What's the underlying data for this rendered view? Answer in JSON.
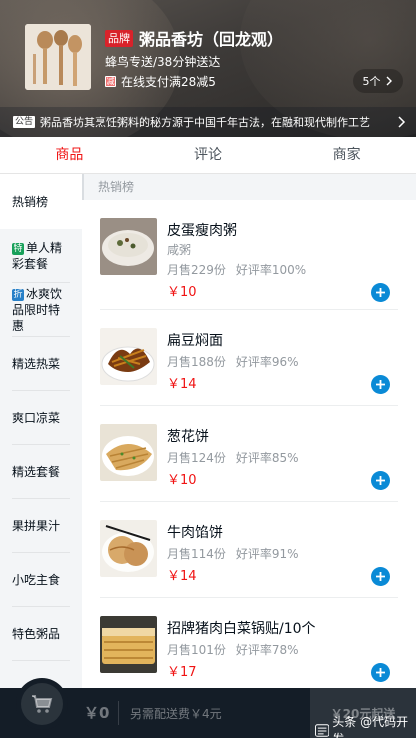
{
  "header": {
    "brand_badge": "品牌",
    "shop_name": "粥品香坊（回龙观）",
    "delivery": "蜂鸟专送/38分钟送达",
    "promo_icon": "减",
    "promo": "在线支付满28减5",
    "promo_count": "5个",
    "notice_tag": "公告",
    "notice": "粥品香坊其烹饪粥料的秘方源于中国千年古法，在融和现代制作工艺"
  },
  "tabs": [
    "商品",
    "评论",
    "商家"
  ],
  "menu": [
    {
      "tag": "",
      "label": "热销榜"
    },
    {
      "tag": "特",
      "label": "单人精彩套餐"
    },
    {
      "tag": "折",
      "label": "冰爽饮品限时特惠"
    },
    {
      "tag": "",
      "label": "精选热菜"
    },
    {
      "tag": "",
      "label": "爽口凉菜"
    },
    {
      "tag": "",
      "label": "精选套餐"
    },
    {
      "tag": "",
      "label": "果拼果汁"
    },
    {
      "tag": "",
      "label": "小吃主食"
    },
    {
      "tag": "",
      "label": "特色粥品"
    }
  ],
  "section_title": "热销榜",
  "foods": [
    {
      "name": "皮蛋瘦肉粥",
      "desc": "咸粥",
      "sales": "月售229份",
      "rating": "好评率100%",
      "price": "￥10"
    },
    {
      "name": "扁豆焖面",
      "desc": "",
      "sales": "月售188份",
      "rating": "好评率96%",
      "price": "￥14"
    },
    {
      "name": "葱花饼",
      "desc": "",
      "sales": "月售124份",
      "rating": "好评率85%",
      "price": "￥10"
    },
    {
      "name": "牛肉馅饼",
      "desc": "",
      "sales": "月售114份",
      "rating": "好评率91%",
      "price": "￥14"
    },
    {
      "name": "招牌猪肉白菜锅贴/10个",
      "desc": "",
      "sales": "月售101份",
      "rating": "好评率78%",
      "price": "￥17"
    }
  ],
  "footer": {
    "total": "￥0",
    "extra_fee": "另需配送费￥4元",
    "min_order": "￥20元起送",
    "watermark": "头条 @代码开发"
  },
  "colors": {
    "accent_red": "#f01414",
    "add_blue": "#0a8ad6",
    "footer_bg": "#141d27"
  }
}
